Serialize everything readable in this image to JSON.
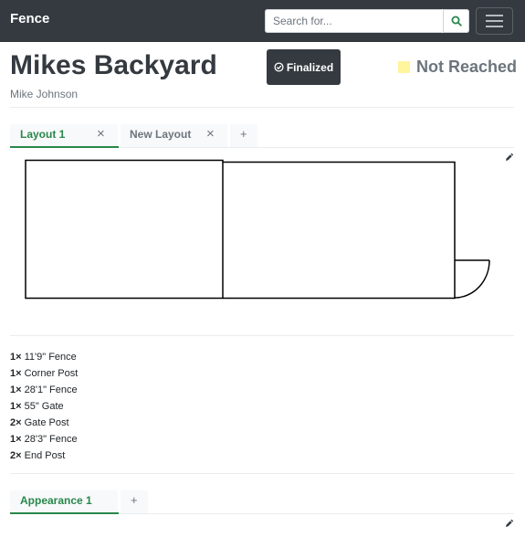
{
  "navbar": {
    "brand": "Fence",
    "search_placeholder": "Search for...",
    "search_icon": "search-icon",
    "menu_icon": "hamburger-menu-icon"
  },
  "header": {
    "title": "Mikes Backyard",
    "owner": "Mike Johnson",
    "finalized_label": "Finalized",
    "finalized_icon": "check-circle-icon",
    "status_label": "Not Reached",
    "status_color": "#fff59d"
  },
  "layout_tabs": [
    {
      "label": "Layout 1",
      "active": true
    },
    {
      "label": "New Layout",
      "active": false
    }
  ],
  "tab_close_glyph": "×",
  "tab_add_glyph": "+",
  "parts": [
    {
      "qty": "1×",
      "name": "11'9\" Fence"
    },
    {
      "qty": "1×",
      "name": "Corner Post"
    },
    {
      "qty": "1×",
      "name": "28'1\" Fence"
    },
    {
      "qty": "1×",
      "name": "55\" Gate"
    },
    {
      "qty": "2×",
      "name": "Gate Post"
    },
    {
      "qty": "1×",
      "name": "28'3\" Fence"
    },
    {
      "qty": "2×",
      "name": "End Post"
    }
  ],
  "appearance_tabs": [
    {
      "label": "Appearance 1",
      "active": true
    }
  ],
  "colors": {
    "navbar": "#343a40",
    "accent_green": "#28874b"
  }
}
